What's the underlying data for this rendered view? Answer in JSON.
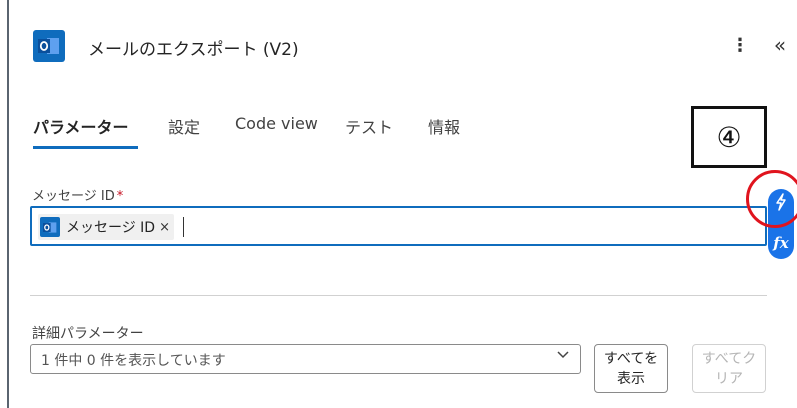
{
  "header": {
    "title": "メールのエクスポート (V2)",
    "more_glyph": "⋮",
    "collapse_glyph": "«"
  },
  "tabs": [
    {
      "label": "パラメーター",
      "active": true
    },
    {
      "label": "設定"
    },
    {
      "label": "Code view"
    },
    {
      "label": "テスト"
    },
    {
      "label": "情報"
    }
  ],
  "annotation": {
    "label": "④"
  },
  "message_id_field": {
    "label": "メッセージ ID",
    "required_mark": "*",
    "token_label": "メッセージ ID",
    "token_remove": "×"
  },
  "side_buttons": {
    "fx_label": "fx"
  },
  "advanced": {
    "label": "詳細パラメーター",
    "dropdown_value": "1 件中 0 件を表示しています",
    "show_all_label": "すべてを表示",
    "clear_all_label": "すべてクリア"
  },
  "colors": {
    "accent": "#0f6cbd",
    "side_button": "#1a73e8",
    "highlight_circle": "#e0141e",
    "required": "#c50f1f"
  },
  "icons": {
    "app": "outlook-icon",
    "token": "outlook-icon",
    "dynamic_content": "lightning-icon",
    "expression": "fx-icon",
    "dropdown": "chevron-down-icon"
  }
}
